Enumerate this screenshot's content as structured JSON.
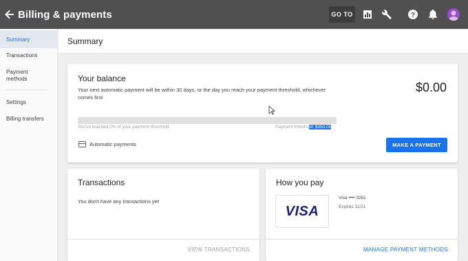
{
  "topbar": {
    "title": "Billing & payments",
    "goto_label": "GO TO",
    "icons": [
      "back-arrow-icon",
      "bar-chart-icon",
      "wrench-icon",
      "help-icon",
      "bell-icon",
      "avatar"
    ],
    "background": "#505050"
  },
  "sidebar": {
    "items": [
      {
        "label": "Summary",
        "active": true
      },
      {
        "label": "Transactions"
      },
      {
        "label": "Payment methods"
      },
      {
        "label": "Settings"
      },
      {
        "label": "Billing transfers"
      }
    ]
  },
  "page": {
    "title": "Summary"
  },
  "balance": {
    "title": "Your balance",
    "description": "Your next automatic payment will be within 30 days, or the day you reach your payment threshold, whichever comes first",
    "amount": "$0.00",
    "progress_fraction": 0,
    "reached_text": "You've reached 0% of your payment threshold",
    "threshold_prefix": "Payment thresho",
    "threshold_highlight": "ld: $350.00",
    "autopay_label": "Automatic payments",
    "make_payment_label": "MAKE A PAYMENT"
  },
  "transactions": {
    "title": "Transactions",
    "empty_text": "You don't have any transactions yet",
    "view_label": "VIEW TRANSACTIONS"
  },
  "how_you_pay": {
    "title": "How you pay",
    "card_brand": "VISA",
    "card_number": "Visa •••• 3281",
    "expires": "Expires 11/21",
    "manage_label": "MANAGE PAYMENT METHODS"
  },
  "colors": {
    "accent": "#1a73e8",
    "visa_blue": "#1a1f71"
  }
}
